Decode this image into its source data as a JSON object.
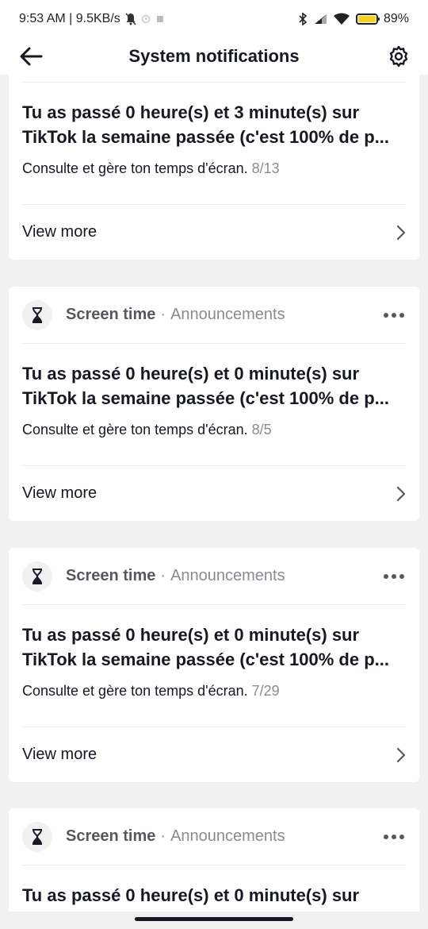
{
  "status_bar": {
    "time_speed": "9:53 AM | 9.5KB/s",
    "battery": "89%"
  },
  "header": {
    "title": "System notifications"
  },
  "cards": [
    {
      "title": "Tu as passé 0 heure(s) et 3 minute(s) sur TikTok la semaine passée (c'est 100% de p...",
      "body": "Consulte et gère ton temps d'écran.",
      "date": "8/13",
      "view_more": "View more"
    },
    {
      "source": "Screen time",
      "separator": "·",
      "category": "Announcements",
      "title": "Tu as passé 0 heure(s) et 0 minute(s) sur TikTok la semaine passée (c'est 100% de p...",
      "body": "Consulte et gère ton temps d'écran.",
      "date": "8/5",
      "view_more": "View more"
    },
    {
      "source": "Screen time",
      "separator": "·",
      "category": "Announcements",
      "title": "Tu as passé 0 heure(s) et 0 minute(s) sur TikTok la semaine passée (c'est 100% de p...",
      "body": "Consulte et gère ton temps d'écran.",
      "date": "7/29",
      "view_more": "View more"
    },
    {
      "source": "Screen time",
      "separator": "·",
      "category": "Announcements",
      "title": "Tu as passé 0 heure(s) et 0 minute(s) sur"
    }
  ],
  "icons": {
    "back": "arrow-left-icon",
    "settings": "gear-icon",
    "card_avatar": "hourglass-icon",
    "more": "ellipsis-icon",
    "chevron": "chevron-right-icon"
  }
}
